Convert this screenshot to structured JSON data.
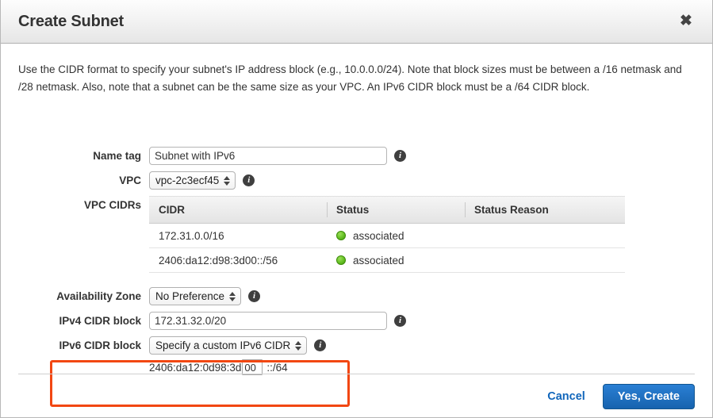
{
  "dialog": {
    "title": "Create Subnet",
    "close_icon": "close-icon",
    "description": "Use the CIDR format to specify your subnet's IP address block (e.g., 10.0.0.0/24). Note that block sizes must be between a /16 netmask and /28 netmask. Also, note that a subnet can be the same size as your VPC. An IPv6 CIDR block must be a /64 CIDR block."
  },
  "form": {
    "name_tag": {
      "label": "Name tag",
      "value": "Subnet with IPv6",
      "placeholder": "",
      "info_icon": "info-icon"
    },
    "vpc": {
      "label": "VPC",
      "value": "vpc-2c3ecf45",
      "info_icon": "info-icon"
    },
    "vpc_cidrs": {
      "label": "VPC CIDRs",
      "columns": [
        "CIDR",
        "Status",
        "Status Reason"
      ],
      "rows": [
        {
          "cidr": "172.31.0.0/16",
          "status": "associated",
          "status_reason": "",
          "status_color": "#6ec62c"
        },
        {
          "cidr": "2406:da12:d98:3d00::/56",
          "status": "associated",
          "status_reason": "",
          "status_color": "#6ec62c"
        }
      ]
    },
    "availability_zone": {
      "label": "Availability Zone",
      "value": "No Preference",
      "info_icon": "info-icon"
    },
    "ipv4_cidr_block": {
      "label": "IPv4 CIDR block",
      "value": "172.31.32.0/20",
      "placeholder": "",
      "info_icon": "info-icon"
    },
    "ipv6_cidr_block": {
      "label": "IPv6 CIDR block",
      "value": "Specify a custom IPv6 CIDR",
      "info_icon": "info-icon",
      "custom": {
        "prefix": "2406:da12:0d98:3d",
        "suffix_value": "00",
        "trailing": "::/64"
      }
    }
  },
  "highlight": {
    "color": "#f24712"
  },
  "footer": {
    "cancel_label": "Cancel",
    "submit_label": "Yes, Create"
  }
}
